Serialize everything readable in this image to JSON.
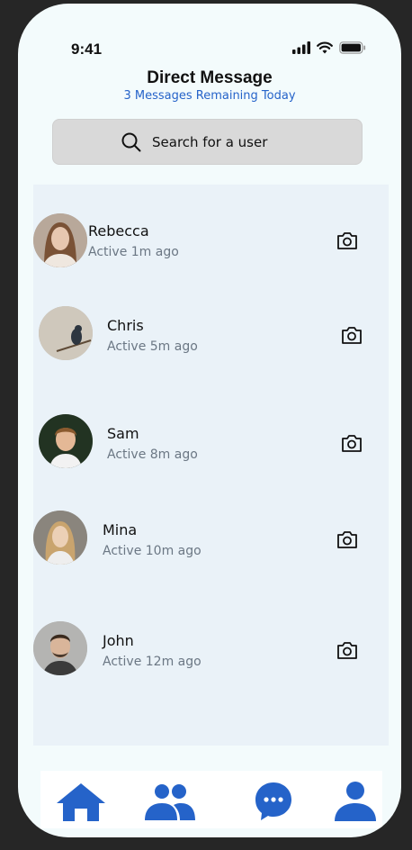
{
  "status_bar": {
    "time": "9:41"
  },
  "header": {
    "title": "Direct Message",
    "subtitle": "3 Messages Remaining Today"
  },
  "search": {
    "placeholder": "Search for a user"
  },
  "contacts": [
    {
      "name": "Rebecca",
      "status": "Active 1m ago"
    },
    {
      "name": "Chris",
      "status": "Active 5m ago"
    },
    {
      "name": "Sam",
      "status": "Active 8m ago"
    },
    {
      "name": "Mina",
      "status": "Active 10m ago"
    },
    {
      "name": "John",
      "status": "Active 12m ago"
    }
  ],
  "bottom_nav": {
    "items": [
      {
        "icon": "home-icon"
      },
      {
        "icon": "people-icon"
      },
      {
        "icon": "chat-icon"
      },
      {
        "icon": "profile-icon"
      }
    ]
  },
  "colors": {
    "accent": "#2563c9",
    "background": "#f3fbfc",
    "list_background": "#eaf2f8",
    "search_background": "#d9d9d9"
  }
}
